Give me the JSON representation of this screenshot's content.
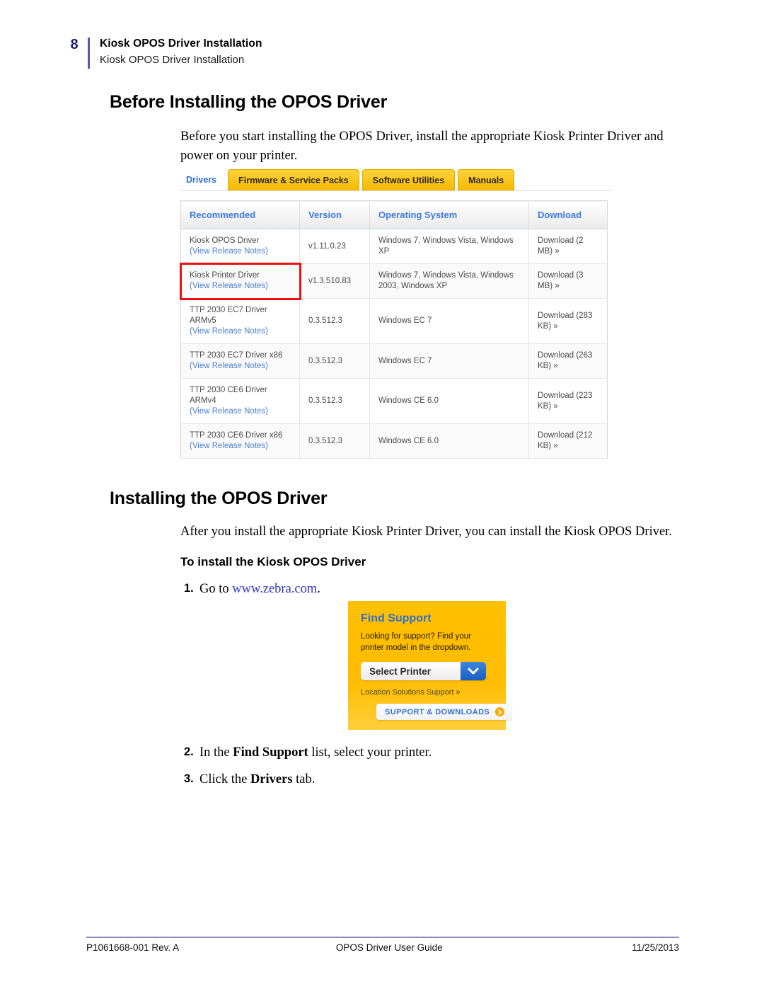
{
  "header": {
    "page_number": "8",
    "title": "Kiosk OPOS Driver Installation",
    "subtitle": "Kiosk OPOS Driver Installation"
  },
  "sections": {
    "before": {
      "heading": "Before Installing the OPOS Driver",
      "paragraph": "Before you start installing the OPOS Driver, install the appropriate Kiosk Printer Driver and power on your printer."
    },
    "installing": {
      "heading": "Installing the OPOS Driver",
      "paragraph": "After you install the appropriate Kiosk Printer Driver, you can install the Kiosk OPOS Driver.",
      "subheading": "To install the Kiosk OPOS Driver"
    }
  },
  "steps": [
    {
      "number": "1.",
      "prefix": "Go to ",
      "link": "www.zebra.com",
      "suffix": "."
    },
    {
      "number": "2.",
      "prefix": "In the ",
      "bold": "Find Support",
      "suffix": " list, select your printer."
    },
    {
      "number": "3.",
      "prefix": "Click the ",
      "bold": "Drivers",
      "suffix": " tab."
    }
  ],
  "drivers_screenshot": {
    "tabs": [
      {
        "label": "Drivers",
        "active": true
      },
      {
        "label": "Firmware & Service Packs",
        "active": false
      },
      {
        "label": "Software Utilities",
        "active": false
      },
      {
        "label": "Manuals",
        "active": false
      }
    ],
    "columns": [
      "Recommended",
      "Version",
      "Operating System",
      "Download"
    ],
    "release_notes_label": "(View Release Notes)",
    "rows": [
      {
        "name": "Kiosk OPOS Driver",
        "release_notes": "(View Release Notes)",
        "version": "v1.11.0.23",
        "os": "Windows 7, Windows Vista, Windows XP",
        "download": "Download (2 MB) »",
        "highlighted": false
      },
      {
        "name": "Kiosk Printer Driver",
        "release_notes": "(View Release Notes)",
        "version": "v1.3.510.83",
        "os": "Windows 7, Windows Vista, Windows 2003, Windows XP",
        "download": "Download (3 MB) »",
        "highlighted": true
      },
      {
        "name": "TTP 2030 EC7 Driver ARMv5",
        "release_notes": "(View Release Notes)",
        "version": "0.3.512.3",
        "os": "Windows EC 7",
        "download": "Download (283 KB) »",
        "highlighted": false
      },
      {
        "name": "TTP 2030 EC7 Driver x86",
        "release_notes": "(View Release Notes)",
        "version": "0.3.512.3",
        "os": "Windows EC 7",
        "download": "Download (263 KB) »",
        "highlighted": false
      },
      {
        "name": "TTP 2030 CE6 Driver ARMv4",
        "release_notes": "(View Release Notes)",
        "version": "0.3.512.3",
        "os": "Windows CE 6.0",
        "download": "Download (223 KB) »",
        "highlighted": false
      },
      {
        "name": "TTP 2030 CE6 Driver x86",
        "release_notes": "(View Release Notes)",
        "version": "0.3.512.3",
        "os": "Windows CE 6.0",
        "download": "Download (212 KB) »",
        "highlighted": false
      }
    ]
  },
  "support_widget": {
    "title": "Find Support",
    "description": "Looking for support? Find your printer model in the dropdown.",
    "select_value": "Select Printer",
    "location_link": "Location Solutions Support »",
    "button_label": "SUPPORT & DOWNLOADS"
  },
  "footer": {
    "left": "P1061668-001 Rev. A",
    "center": "OPOS Driver User Guide",
    "right": "11/25/2013"
  },
  "colors": {
    "page_number": "#1b1b6f",
    "header_rule": "#5a5ab4",
    "tab_yellow": "#ffc800",
    "tab_active_text": "#2f6fd0",
    "table_header_text": "#3a7ae0",
    "link_blue": "#4a7fd4",
    "highlight_red": "#ee1111",
    "support_bg": "#ffc000"
  }
}
